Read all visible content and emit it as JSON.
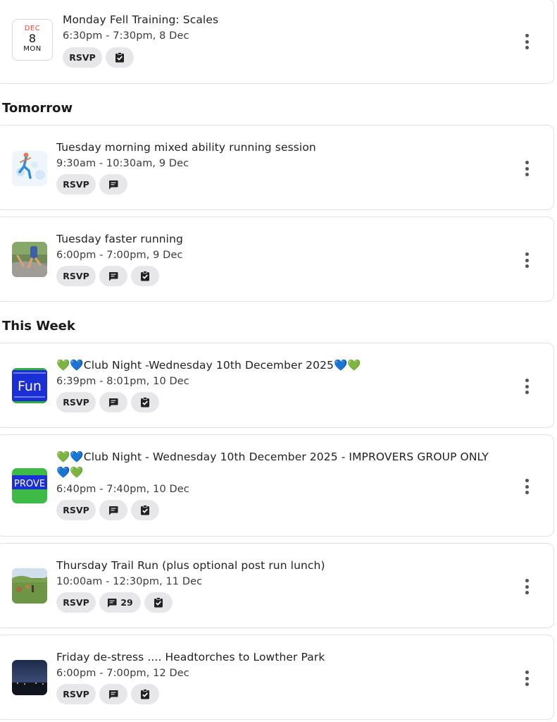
{
  "sections": {
    "tomorrow": "Tomorrow",
    "this_week": "This Week"
  },
  "events": [
    {
      "title": "Monday Fell Training: Scales",
      "time": "6:30pm - 7:30pm, 8 Dec",
      "date_month": "DEC",
      "date_day": "8",
      "date_weekday": "MON",
      "rsvp_label": "RSVP",
      "chips": [
        "check-clipboard-icon"
      ]
    },
    {
      "title": "Tuesday morning mixed ability running session",
      "time": "9:30am - 10:30am, 9 Dec",
      "rsvp_label": "RSVP",
      "chips": [
        "comment-icon"
      ]
    },
    {
      "title": "Tuesday faster running",
      "time": "6:00pm - 7:00pm, 9 Dec",
      "rsvp_label": "RSVP",
      "chips": [
        "comment-icon",
        "check-clipboard-icon"
      ]
    },
    {
      "title": "💚💙Club Night -Wednesday 10th December 2025💙💚",
      "time": "6:39pm - 8:01pm, 10 Dec",
      "thumb_text": "Fun",
      "rsvp_label": "RSVP",
      "chips": [
        "comment-icon",
        "check-clipboard-icon"
      ]
    },
    {
      "title_line1": "💚💙Club Night - Wednesday 10th December 2025 - IMPROVERS GROUP ONLY",
      "title_line2": "💙💚",
      "time": "6:40pm - 7:40pm, 10 Dec",
      "thumb_text": "PROVE",
      "rsvp_label": "RSVP",
      "chips": [
        "comment-icon",
        "check-clipboard-icon"
      ]
    },
    {
      "title": "Thursday Trail Run (plus optional post run lunch)",
      "time": "10:00am - 12:30pm, 11 Dec",
      "comment_count": "29",
      "rsvp_label": "RSVP",
      "chips": [
        "comment-icon",
        "check-clipboard-icon"
      ]
    },
    {
      "title": "Friday de-stress .... Headtorches to Lowther Park",
      "time": "6:00pm - 7:00pm, 12 Dec",
      "rsvp_label": "RSVP",
      "chips": [
        "comment-icon",
        "check-clipboard-icon"
      ]
    }
  ],
  "colors": {
    "chip_bg": "#e7e7ea",
    "date_month": "#e2473b",
    "card_border": "#e2e2e4",
    "thumb_blue": "#1b2fd6",
    "thumb_green": "#2fae3b"
  }
}
